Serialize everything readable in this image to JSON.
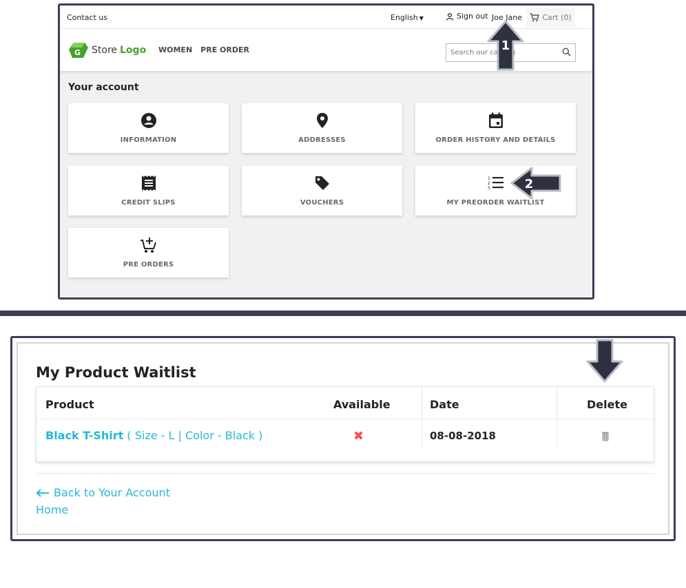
{
  "topbar": {
    "contact": "Contact us",
    "language": "English",
    "signout": "Sign out",
    "username": "Joe Jane",
    "cart": "Cart (0)"
  },
  "header": {
    "logo_store": "Store",
    "logo_word": "Logo",
    "nav": [
      "WOMEN",
      "PRE ORDER"
    ],
    "search_placeholder": "Search our catalog"
  },
  "account": {
    "title": "Your account",
    "tiles": [
      {
        "label": "INFORMATION",
        "icon": "account-circle-icon"
      },
      {
        "label": "ADDRESSES",
        "icon": "location-pin-icon"
      },
      {
        "label": "ORDER HISTORY AND DETAILS",
        "icon": "calendar-icon"
      },
      {
        "label": "CREDIT SLIPS",
        "icon": "receipt-icon"
      },
      {
        "label": "VOUCHERS",
        "icon": "tag-icon"
      },
      {
        "label": "MY PREORDER WAITLIST",
        "icon": "numbered-list-icon"
      },
      {
        "label": "PRE ORDERS",
        "icon": "add-cart-icon"
      }
    ]
  },
  "annotations": [
    "1",
    "2"
  ],
  "waitlist": {
    "title": "My Product Waitlist",
    "headers": [
      "Product",
      "Available",
      "Date",
      "Delete"
    ],
    "rows": [
      {
        "product": "Black T-Shirt",
        "variant": "( Size - L | Color - Black )",
        "available": "✖",
        "date": "08-08-2018"
      }
    ],
    "back_link": "Back to Your Account",
    "home_link": "Home"
  },
  "colors": {
    "frame": "#3a4052",
    "link": "#24b9d7",
    "logo_green": "#45a32c",
    "unavailable": "#ff4c4c"
  }
}
